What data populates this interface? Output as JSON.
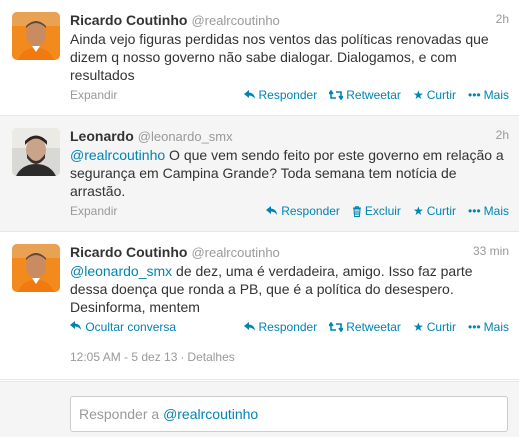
{
  "tweets": [
    {
      "name": "Ricardo Coutinho",
      "handle": "@realrcoutinho",
      "time": "2h",
      "text": "Ainda vejo figuras perdidas nos ventos das políticas renovadas que dizem q nosso governo não sabe dialogar. Dialogamos, e com resultados",
      "expand_label": "Expandir",
      "actions": [
        "Responder",
        "Retweetar",
        "Curtir",
        "Mais"
      ]
    },
    {
      "name": "Leonardo",
      "handle": "@leonardo_smx",
      "time": "2h",
      "mention": "@realrcoutinho",
      "text": " O que vem sendo feito por este governo em relação a segurança em Campina Grande? Toda semana tem notícia de arrastão.",
      "expand_label": "Expandir",
      "actions": [
        "Responder",
        "Excluir",
        "Curtir",
        "Mais"
      ]
    },
    {
      "name": "Ricardo Coutinho",
      "handle": "@realrcoutinho",
      "time": "33 min",
      "mention": "@leonardo_smx",
      "text": " de dez, uma é verdadeira, amigo. Isso faz parte dessa doença que ronda a PB, que é a política do desespero. Desinforma, mentem",
      "hide_label": "Ocultar conversa",
      "actions": [
        "Responder",
        "Retweetar",
        "Curtir",
        "Mais"
      ],
      "timestamp": "12:05 AM - 5 dez 13",
      "details": "Detalhes"
    }
  ],
  "reply": {
    "prefix": "Responder a ",
    "mention": "@realrcoutinho"
  },
  "colors": {
    "link": "#0084b4",
    "muted": "#999999",
    "avatar_orange": "#f28a1e"
  },
  "icons": {
    "reply": "reply-arrow-icon",
    "retweet": "retweet-icon",
    "favorite": "star-icon",
    "more": "more-dots-icon",
    "delete": "trash-icon"
  }
}
